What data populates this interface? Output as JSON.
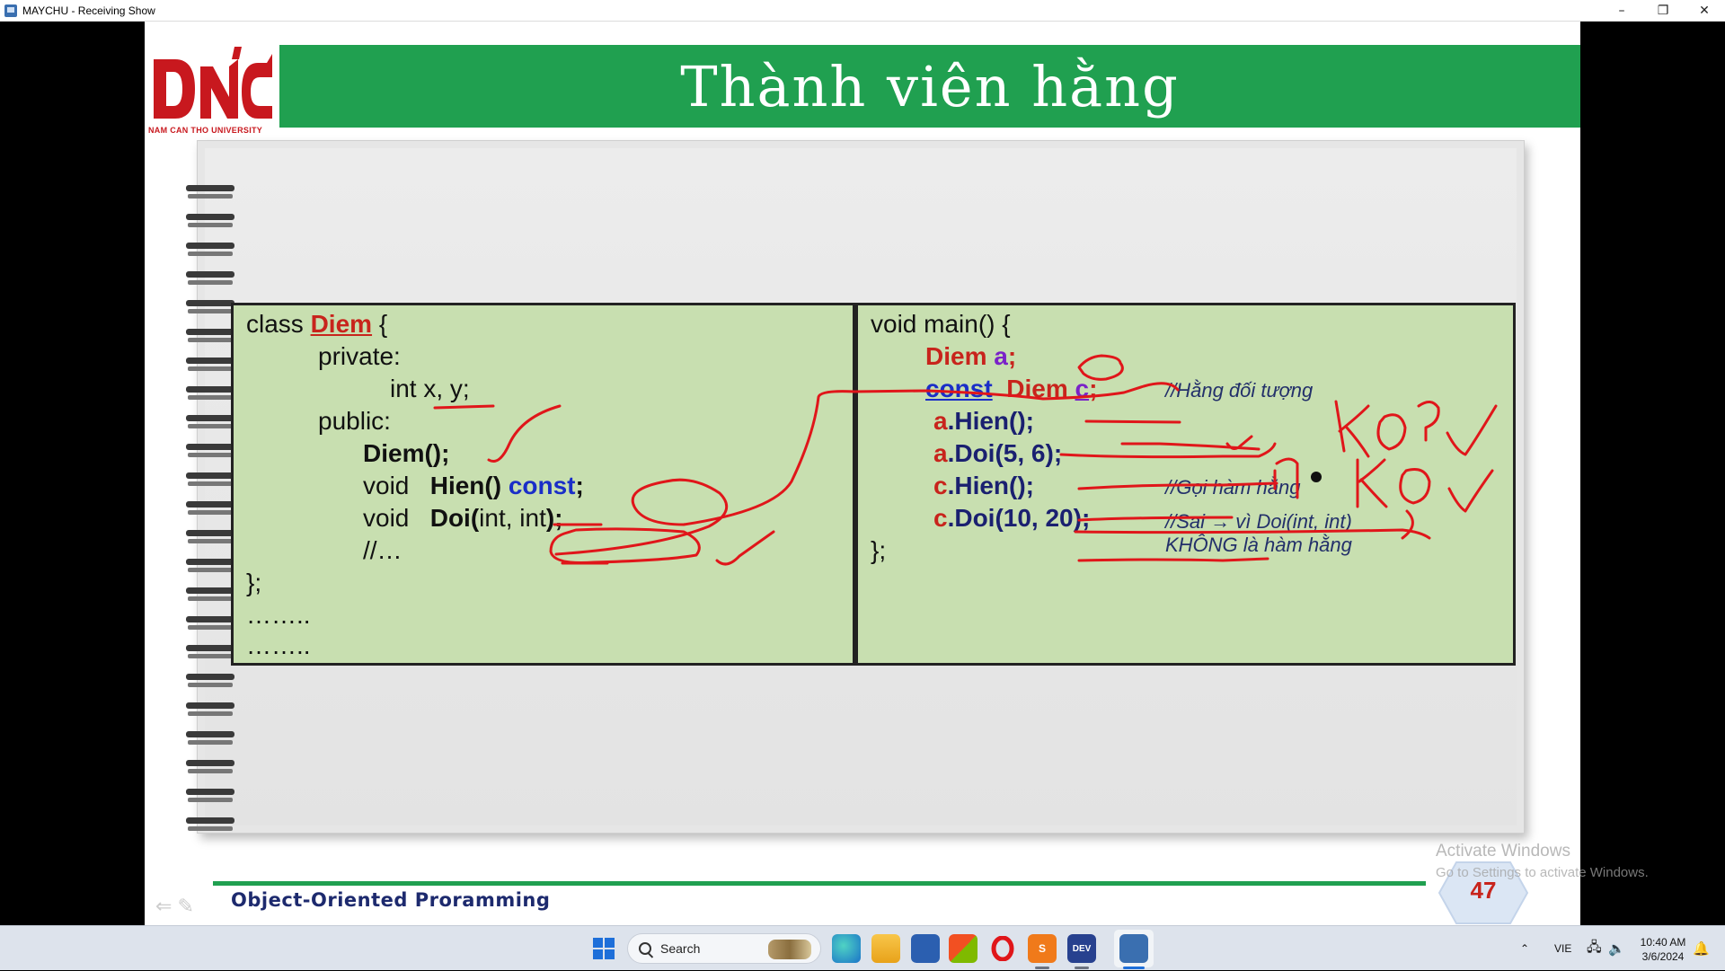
{
  "window": {
    "title": "MAYCHU - Receiving Show",
    "minimize": "–",
    "restore": "❐",
    "close": "✕"
  },
  "slide": {
    "title": "Thành viên hằng",
    "logo_text": "NAM CAN THO UNIVERSITY",
    "footer": "Object-Oriented Proramming",
    "page_number": "47",
    "left_code": {
      "l1_kw": "class ",
      "l1_name": "Diem",
      "l1_end": " {",
      "l2": "private:",
      "l3": "int x, y;",
      "l4": "public:",
      "l5": "Diem();",
      "l6_kw": "void",
      "l6_fn": "Hien()",
      "l6_const": "const",
      "l6_end": ";",
      "l7_kw": "void",
      "l7_fn": "Doi(",
      "l7_args": "int, int",
      "l7_end": ");",
      "l8": "//…",
      "l9": "};",
      "l10": "……..",
      "l11": "……..",
      "l6_sep": "   "
    },
    "right_code": {
      "r1": "void main() {",
      "r2_type": "Diem ",
      "r2_var": "a",
      "r2_end": ";",
      "r3_const": "const",
      "r3_type": "Diem",
      "r3_var": "c",
      "r3_end": ";",
      "r3_comment": "//Hằng đối tượng",
      "r4_obj": "a",
      "r4_call": ".Hien();",
      "r5_obj": "a",
      "r5_call": ".Doi(5, 6);",
      "r6_obj": "c",
      "r6_call": ".Hien();",
      "r6_comment": "//Gọi hàm hằng",
      "r7_obj": "c",
      "r7_call": ".Doi(10, 20);",
      "r7_comment1": "//Sai → vì Doi(int, int)",
      "r7_comment2": "KHÔNG là hàm hằng",
      "r8": "};"
    },
    "annotations": {
      "mark1": "KO?",
      "mark2": "KO"
    }
  },
  "watermark": {
    "title": "Activate Windows",
    "subtitle": "Go to Settings to activate Windows."
  },
  "taskbar": {
    "search_label": "Search",
    "language": "VIE",
    "time": "10:40 AM",
    "date": "3/6/2024",
    "dev_label": "DEV"
  },
  "colors": {
    "header_green": "#20a050",
    "code_bg": "#c8dfb0",
    "annotation_red": "#e0161a",
    "brand_red": "#c8181e"
  }
}
